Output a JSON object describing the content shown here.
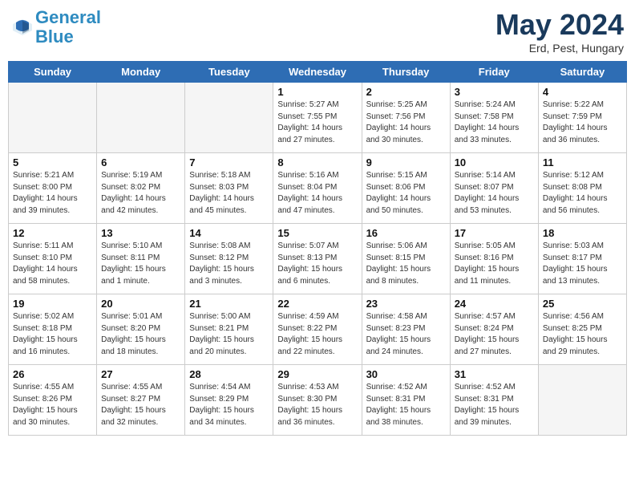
{
  "header": {
    "logo_line1": "General",
    "logo_line2": "Blue",
    "month_title": "May 2024",
    "subtitle": "Erd, Pest, Hungary"
  },
  "weekdays": [
    "Sunday",
    "Monday",
    "Tuesday",
    "Wednesday",
    "Thursday",
    "Friday",
    "Saturday"
  ],
  "weeks": [
    [
      {
        "day": "",
        "info": ""
      },
      {
        "day": "",
        "info": ""
      },
      {
        "day": "",
        "info": ""
      },
      {
        "day": "1",
        "info": "Sunrise: 5:27 AM\nSunset: 7:55 PM\nDaylight: 14 hours\nand 27 minutes."
      },
      {
        "day": "2",
        "info": "Sunrise: 5:25 AM\nSunset: 7:56 PM\nDaylight: 14 hours\nand 30 minutes."
      },
      {
        "day": "3",
        "info": "Sunrise: 5:24 AM\nSunset: 7:58 PM\nDaylight: 14 hours\nand 33 minutes."
      },
      {
        "day": "4",
        "info": "Sunrise: 5:22 AM\nSunset: 7:59 PM\nDaylight: 14 hours\nand 36 minutes."
      }
    ],
    [
      {
        "day": "5",
        "info": "Sunrise: 5:21 AM\nSunset: 8:00 PM\nDaylight: 14 hours\nand 39 minutes."
      },
      {
        "day": "6",
        "info": "Sunrise: 5:19 AM\nSunset: 8:02 PM\nDaylight: 14 hours\nand 42 minutes."
      },
      {
        "day": "7",
        "info": "Sunrise: 5:18 AM\nSunset: 8:03 PM\nDaylight: 14 hours\nand 45 minutes."
      },
      {
        "day": "8",
        "info": "Sunrise: 5:16 AM\nSunset: 8:04 PM\nDaylight: 14 hours\nand 47 minutes."
      },
      {
        "day": "9",
        "info": "Sunrise: 5:15 AM\nSunset: 8:06 PM\nDaylight: 14 hours\nand 50 minutes."
      },
      {
        "day": "10",
        "info": "Sunrise: 5:14 AM\nSunset: 8:07 PM\nDaylight: 14 hours\nand 53 minutes."
      },
      {
        "day": "11",
        "info": "Sunrise: 5:12 AM\nSunset: 8:08 PM\nDaylight: 14 hours\nand 56 minutes."
      }
    ],
    [
      {
        "day": "12",
        "info": "Sunrise: 5:11 AM\nSunset: 8:10 PM\nDaylight: 14 hours\nand 58 minutes."
      },
      {
        "day": "13",
        "info": "Sunrise: 5:10 AM\nSunset: 8:11 PM\nDaylight: 15 hours\nand 1 minute."
      },
      {
        "day": "14",
        "info": "Sunrise: 5:08 AM\nSunset: 8:12 PM\nDaylight: 15 hours\nand 3 minutes."
      },
      {
        "day": "15",
        "info": "Sunrise: 5:07 AM\nSunset: 8:13 PM\nDaylight: 15 hours\nand 6 minutes."
      },
      {
        "day": "16",
        "info": "Sunrise: 5:06 AM\nSunset: 8:15 PM\nDaylight: 15 hours\nand 8 minutes."
      },
      {
        "day": "17",
        "info": "Sunrise: 5:05 AM\nSunset: 8:16 PM\nDaylight: 15 hours\nand 11 minutes."
      },
      {
        "day": "18",
        "info": "Sunrise: 5:03 AM\nSunset: 8:17 PM\nDaylight: 15 hours\nand 13 minutes."
      }
    ],
    [
      {
        "day": "19",
        "info": "Sunrise: 5:02 AM\nSunset: 8:18 PM\nDaylight: 15 hours\nand 16 minutes."
      },
      {
        "day": "20",
        "info": "Sunrise: 5:01 AM\nSunset: 8:20 PM\nDaylight: 15 hours\nand 18 minutes."
      },
      {
        "day": "21",
        "info": "Sunrise: 5:00 AM\nSunset: 8:21 PM\nDaylight: 15 hours\nand 20 minutes."
      },
      {
        "day": "22",
        "info": "Sunrise: 4:59 AM\nSunset: 8:22 PM\nDaylight: 15 hours\nand 22 minutes."
      },
      {
        "day": "23",
        "info": "Sunrise: 4:58 AM\nSunset: 8:23 PM\nDaylight: 15 hours\nand 24 minutes."
      },
      {
        "day": "24",
        "info": "Sunrise: 4:57 AM\nSunset: 8:24 PM\nDaylight: 15 hours\nand 27 minutes."
      },
      {
        "day": "25",
        "info": "Sunrise: 4:56 AM\nSunset: 8:25 PM\nDaylight: 15 hours\nand 29 minutes."
      }
    ],
    [
      {
        "day": "26",
        "info": "Sunrise: 4:55 AM\nSunset: 8:26 PM\nDaylight: 15 hours\nand 30 minutes."
      },
      {
        "day": "27",
        "info": "Sunrise: 4:55 AM\nSunset: 8:27 PM\nDaylight: 15 hours\nand 32 minutes."
      },
      {
        "day": "28",
        "info": "Sunrise: 4:54 AM\nSunset: 8:29 PM\nDaylight: 15 hours\nand 34 minutes."
      },
      {
        "day": "29",
        "info": "Sunrise: 4:53 AM\nSunset: 8:30 PM\nDaylight: 15 hours\nand 36 minutes."
      },
      {
        "day": "30",
        "info": "Sunrise: 4:52 AM\nSunset: 8:31 PM\nDaylight: 15 hours\nand 38 minutes."
      },
      {
        "day": "31",
        "info": "Sunrise: 4:52 AM\nSunset: 8:31 PM\nDaylight: 15 hours\nand 39 minutes."
      },
      {
        "day": "",
        "info": ""
      }
    ]
  ]
}
